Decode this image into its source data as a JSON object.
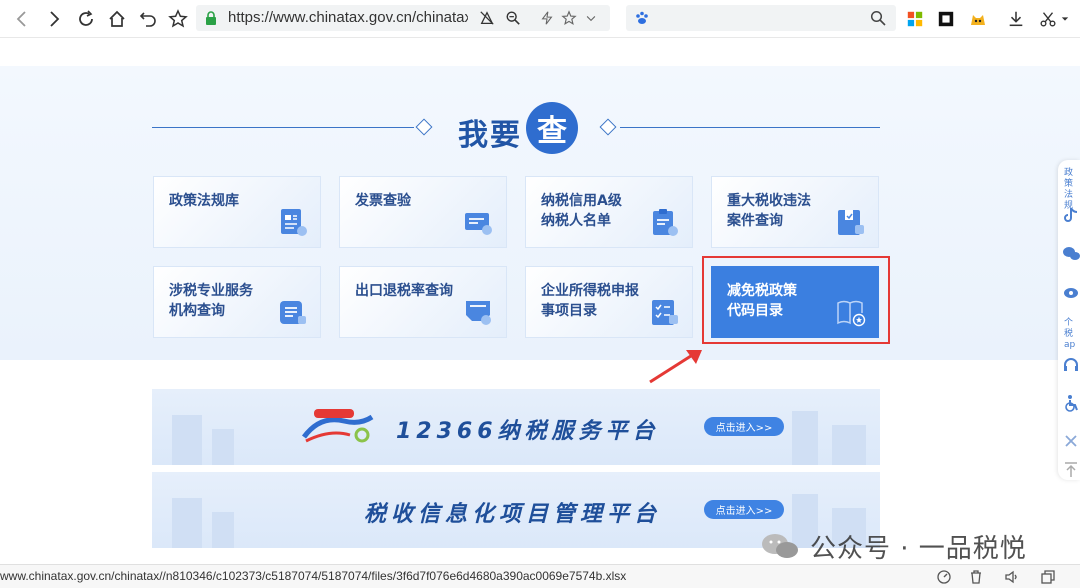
{
  "browser": {
    "url": "https://www.chinatax.gov.cn/chinatax/r",
    "status_url": "www.chinatax.gov.cn/chinatax//n810346/c102373/c5187074/5187074/files/3f6d7f076e6d4680a390ac0069e7574b.xlsx"
  },
  "heading": {
    "text": "我要",
    "badge": "查"
  },
  "cards": [
    {
      "label": "政策法规库",
      "icon": "document-edit-icon"
    },
    {
      "label": "发票查验",
      "icon": "invoice-search-icon"
    },
    {
      "label": "纳税信用A级\n纳税人名单",
      "icon": "clipboard-user-icon"
    },
    {
      "label": "重大税收违法\n案件查询",
      "icon": "case-file-icon"
    },
    {
      "label": "涉税专业服务\n机构查询",
      "icon": "list-lock-icon"
    },
    {
      "label": "出口退税率查询",
      "icon": "ticket-search-icon"
    },
    {
      "label": "企业所得税申报\n事项目录",
      "icon": "checklist-icon"
    },
    {
      "label": "减免税政策\n代码目录",
      "icon": "book-star-icon"
    }
  ],
  "banners": [
    {
      "title": "12366纳税服务平台",
      "button": "点击进入>>"
    },
    {
      "title": "税收信息化项目管理平台",
      "button": "点击进入>>"
    }
  ],
  "sidebar": {
    "top_label": "政策\n法规",
    "bottom_label": "个税\nap"
  },
  "watermark": {
    "text": "公众号 · 一品税悦"
  },
  "colors": {
    "primary": "#2f6dcf",
    "active_card": "#3b7fe0",
    "highlight": "#e53935"
  }
}
